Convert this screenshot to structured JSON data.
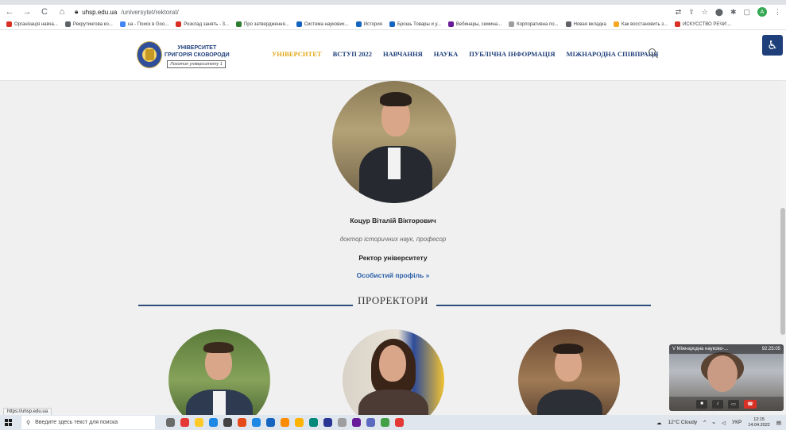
{
  "browser": {
    "url_host": "uhsp.edu.ua",
    "url_path": "/universytet/rektorat/",
    "bookmarks": [
      {
        "label": "Організація навча...",
        "color": "#d93025"
      },
      {
        "label": "Рекрутингова ко...",
        "color": "#5f6368"
      },
      {
        "label": "ua - Поиск в Goo...",
        "color": "#4285f4"
      },
      {
        "label": "Розклад занять - 3...",
        "color": "#d93025"
      },
      {
        "label": "Про затвердження...",
        "color": "#2e7d32"
      },
      {
        "label": "Система наукових...",
        "color": "#1565c0"
      },
      {
        "label": "История",
        "color": "#1565c0"
      },
      {
        "label": "Брошь Товары и у...",
        "color": "#1565c0"
      },
      {
        "label": "Вебинары, семина...",
        "color": "#6a1b9a"
      },
      {
        "label": "Корпоративна по...",
        "color": "#9e9e9e"
      },
      {
        "label": "Новая вкладка",
        "color": "#5f6368"
      },
      {
        "label": "Как восстановить з...",
        "color": "#f9a825"
      },
      {
        "label": "ИСКУССТВО РЕЧИ:...",
        "color": "#d93025"
      }
    ],
    "profile_initial": "A"
  },
  "site": {
    "university_name_line1": "УНІВЕРСИТЕТ",
    "university_name_line2": "ГРИГОРІЯ СКОВОРОДИ",
    "logo_tooltip": "Логотип університету 1",
    "nav": [
      "УНІВЕРСИТЕТ",
      "ВСТУП 2022",
      "НАВЧАННЯ",
      "НАУКА",
      "ПУБЛІЧНА ІНФОРМАЦІЯ",
      "МІЖНАРОДНА СПІВПРАЦЯ"
    ],
    "accent_color": "#e2a81b",
    "brand_color": "#1f3f7a"
  },
  "rector": {
    "name": "Коцур Віталій Вікторович",
    "degree": "доктор історичних наук, професор",
    "title": "Ректор університету",
    "profile_link": "Особистий профіль  »"
  },
  "section": {
    "title": "ПРОРЕКТОРИ"
  },
  "video_call": {
    "title": "V Міжнародна науково-...",
    "time": "92:25:05"
  },
  "status_bar_url": "https://uhsp.edu.ua",
  "taskbar": {
    "search_placeholder": "Введите здесь текст для поиска",
    "weather": "12°C  Cloudy",
    "lang": "УКР",
    "time": "12:15",
    "date": "14.04.2022"
  }
}
